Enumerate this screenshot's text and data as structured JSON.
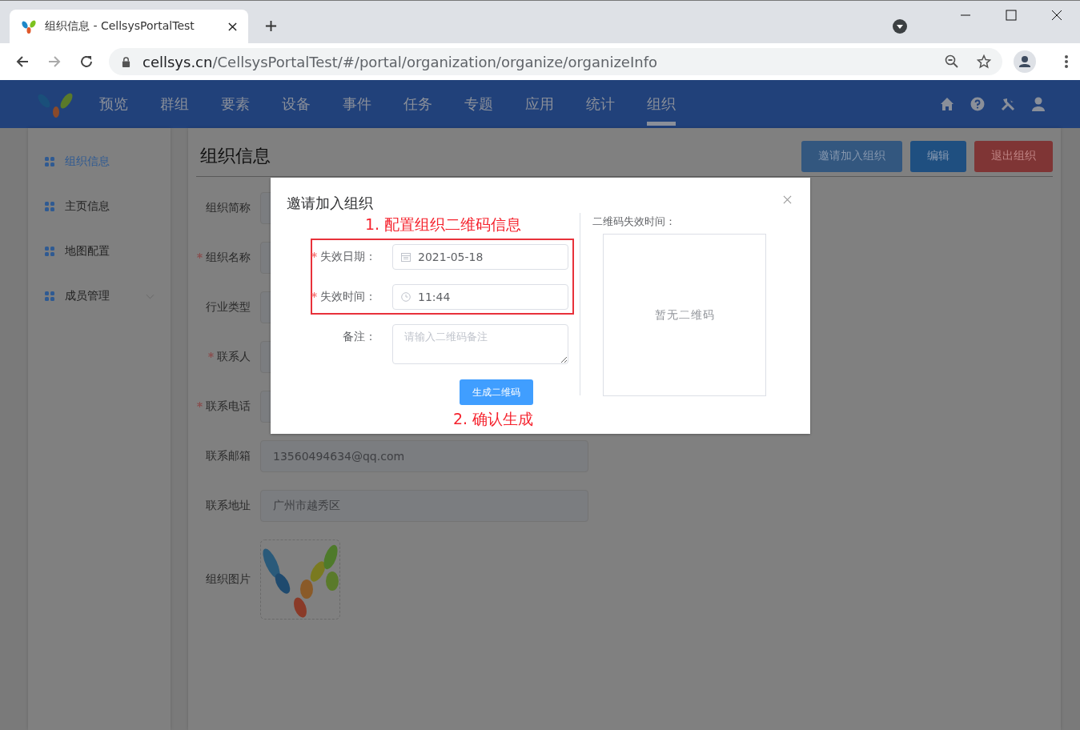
{
  "browser": {
    "tab": {
      "title": "组织信息 - CellsysPortalTest"
    },
    "url": {
      "host": "cellsys.cn",
      "path": "/CellsysPortalTest/#/portal/organization/organize/organizeInfo"
    }
  },
  "nav": {
    "items": [
      {
        "label": "预览",
        "selected": false
      },
      {
        "label": "群组",
        "selected": false
      },
      {
        "label": "要素",
        "selected": false
      },
      {
        "label": "设备",
        "selected": false
      },
      {
        "label": "事件",
        "selected": false
      },
      {
        "label": "任务",
        "selected": false
      },
      {
        "label": "专题",
        "selected": false
      },
      {
        "label": "应用",
        "selected": false
      },
      {
        "label": "统计",
        "selected": false
      },
      {
        "label": "组织",
        "selected": true
      }
    ]
  },
  "sidebar": {
    "items": [
      {
        "label": "组织信息",
        "selected": true
      },
      {
        "label": "主页信息",
        "selected": false
      },
      {
        "label": "地图配置",
        "selected": false
      },
      {
        "label": "成员管理",
        "selected": false,
        "expanded": false
      }
    ]
  },
  "page": {
    "title": "组织信息",
    "buttons": [
      {
        "label": "邀请加入组织",
        "kind": "invite"
      },
      {
        "label": "编辑",
        "kind": "edit"
      },
      {
        "label": "退出组织",
        "kind": "danger"
      }
    ]
  },
  "form": {
    "fields": [
      {
        "label": "组织简称",
        "required": false,
        "kind": "input"
      },
      {
        "label": "组织名称",
        "required": true,
        "kind": "input"
      },
      {
        "label": "行业类型",
        "required": false,
        "kind": "input"
      },
      {
        "label": "联系人",
        "required": true,
        "kind": "input"
      },
      {
        "label": "联系电话",
        "required": true,
        "kind": "input"
      },
      {
        "label": "联系邮箱",
        "required": false,
        "kind": "input",
        "value": "13560494634@qq.com"
      },
      {
        "label": "联系地址",
        "required": false,
        "kind": "input",
        "value": "广州市越秀区"
      },
      {
        "label": "组织图片",
        "required": false,
        "kind": "image"
      }
    ]
  },
  "dialog": {
    "title": "邀请加入组织",
    "step_1": "1. 配置组织二维码信息",
    "fields": [
      {
        "label": "失效日期：",
        "required": true,
        "kind": "date",
        "value": "2021-05-18"
      },
      {
        "label": "失效时间：",
        "required": true,
        "kind": "time",
        "value": "11:44"
      },
      {
        "label": "备注：",
        "required": false,
        "kind": "textarea",
        "placeholder": "请输入二维码备注"
      }
    ],
    "button": "生成二维码",
    "step_2": "2. 确认生成",
    "qr_label": "二维码失效时间：",
    "qr_empty": "暂无二维码"
  }
}
